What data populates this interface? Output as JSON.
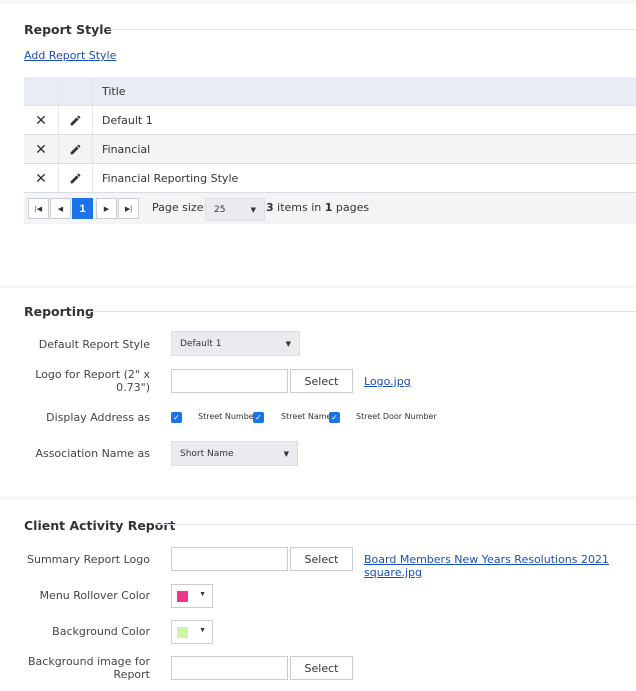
{
  "report_style": {
    "title": "Report Style",
    "add_link": "Add Report Style",
    "grid": {
      "column_title": "Title",
      "rows": [
        {
          "title": "Default 1"
        },
        {
          "title": "Financial"
        },
        {
          "title": "Financial Reporting Style"
        }
      ]
    },
    "pager": {
      "first_icon": "first-page-icon",
      "prev_icon": "prev-page-icon",
      "current_page": "1",
      "next_icon": "next-page-icon",
      "last_icon": "last-page-icon",
      "page_size_label": "Page size:",
      "page_size_value": "25",
      "items_count": "3",
      "items_in_text": "items in",
      "pages_count": "1",
      "pages_text": "pages"
    }
  },
  "reporting": {
    "title": "Reporting",
    "default_report_style": {
      "label": "Default Report Style",
      "value": "Default 1"
    },
    "logo": {
      "label_line1": "Logo for Report (2\" x",
      "label_line2": "0.73\")",
      "select_label": "Select",
      "file_link": "Logo.jpg"
    },
    "display_address": {
      "label": "Display Address as",
      "options": [
        {
          "label": "Street Number",
          "checked": true
        },
        {
          "label": "Street Name",
          "checked": true
        },
        {
          "label": "Street Door Number",
          "checked": true
        }
      ]
    },
    "association_name": {
      "label": "Association Name as",
      "value": "Short Name"
    }
  },
  "client_activity": {
    "title": "Client Activity Report",
    "summary_logo": {
      "label": "Summary Report Logo",
      "select_label": "Select",
      "file_link": "Board Members New Years Resolutions 2021 square.jpg"
    },
    "menu_rollover": {
      "label": "Menu Rollover Color",
      "color": "#f0358f"
    },
    "background_color": {
      "label": "Background Color",
      "color": "#ccf5a6"
    },
    "background_image": {
      "label_line1": "Background image for",
      "label_line2": "Report",
      "select_label": "Select"
    }
  },
  "colors": {
    "accent": "#1a73e8",
    "link": "#1a4fb5"
  }
}
